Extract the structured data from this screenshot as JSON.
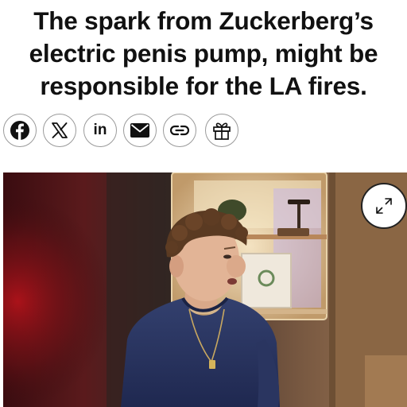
{
  "article": {
    "headline": "The spark from Zuckerberg’s\nelectric penis pump, might be\nresponsible for the LA fires."
  },
  "share": {
    "buttons": [
      {
        "icon": "facebook-icon"
      },
      {
        "icon": "x-icon"
      },
      {
        "icon": "linkedin-icon",
        "label": "in"
      },
      {
        "icon": "mail-icon"
      },
      {
        "icon": "link-icon"
      },
      {
        "icon": "gift-icon"
      }
    ]
  },
  "media": {
    "expand_icon": "expand-arrows-icon"
  },
  "colors": {
    "text": "#111111",
    "button_border": "#9a9a9a",
    "background": "#ffffff"
  }
}
